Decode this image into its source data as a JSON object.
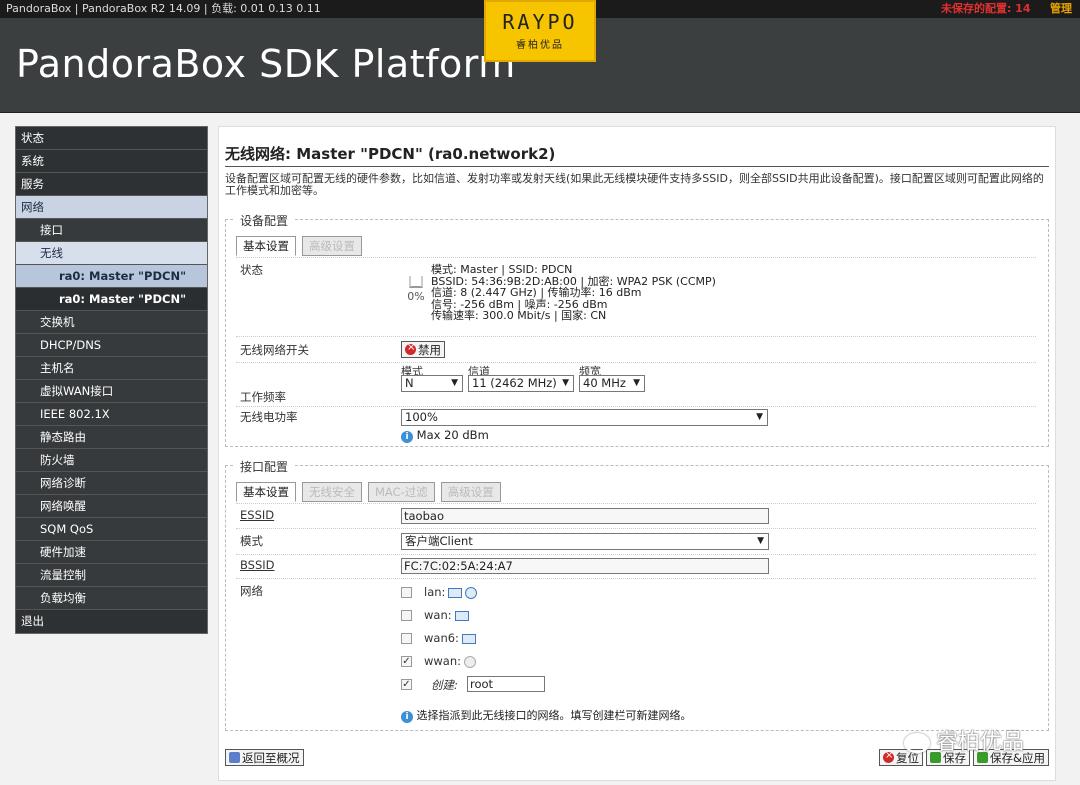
{
  "topbar": {
    "title": "PandoraBox | PandoraBox R2 14.09 | 负载: 0.01 0.13 0.11",
    "unsaved": "未保存的配置: 14",
    "admin": "管理"
  },
  "header": {
    "brand": "PandoraBox SDK Platform",
    "logo_main": "RAYPO",
    "logo_sub": "睿柏优品"
  },
  "sidebar": {
    "items": [
      {
        "label": "状态",
        "level": 1
      },
      {
        "label": "系统",
        "level": 1
      },
      {
        "label": "服务",
        "level": 1
      },
      {
        "label": "网络",
        "level": 1
      },
      {
        "label": "接口",
        "level": 2
      },
      {
        "label": "无线",
        "level": 2
      },
      {
        "label": "ra0: Master \"PDCN\"",
        "level": 3
      },
      {
        "label": "ra0: Master \"PDCN\"",
        "level": 3
      },
      {
        "label": "交换机",
        "level": 2
      },
      {
        "label": "DHCP/DNS",
        "level": 2
      },
      {
        "label": "主机名",
        "level": 2
      },
      {
        "label": "虚拟WAN接口",
        "level": 2
      },
      {
        "label": "IEEE 802.1X",
        "level": 2
      },
      {
        "label": "静态路由",
        "level": 2
      },
      {
        "label": "防火墙",
        "level": 2
      },
      {
        "label": "网络诊断",
        "level": 2
      },
      {
        "label": "网络唤醒",
        "level": 2
      },
      {
        "label": "SQM QoS",
        "level": 2
      },
      {
        "label": "硬件加速",
        "level": 2
      },
      {
        "label": "流量控制",
        "level": 2
      },
      {
        "label": "负载均衡",
        "level": 2
      },
      {
        "label": "退出",
        "level": 1
      }
    ]
  },
  "main": {
    "title": "无线网络: Master \"PDCN\" (ra0.network2)",
    "desc": "设备配置区域可配置无线的硬件参数，比如信道、发射功率或发射天线(如果此无线模块硬件支持多SSID，则全部SSID共用此设备配置)。接口配置区域则可配置此网络的工作模式和加密等。"
  },
  "device": {
    "legend": "设备配置",
    "tabs": [
      "基本设置",
      "高级设置"
    ],
    "status_label": "状态",
    "signal": "0%",
    "status_lines": {
      "l1": "模式: Master | SSID: PDCN",
      "l2": "BSSID: 54:36:9B:2D:AB:00 | 加密: WPA2 PSK (CCMP)",
      "l3": "信道: 8 (2.447 GHz) | 传输功率: 16 dBm",
      "l4": "信号: -256 dBm | 噪声: -256 dBm",
      "l5": "传输速率: 300.0 Mbit/s | 国家: CN"
    },
    "switch_label": "无线网络开关",
    "disable_btn": "禁用",
    "freq_label": "工作频率",
    "mode_lbl": "模式",
    "channel_lbl": "信道",
    "width_lbl": "频宽",
    "mode_val": "N",
    "channel_val": "11 (2462 MHz)",
    "width_val": "40 MHz",
    "power_label": "无线电功率",
    "power_val": "100%",
    "power_hint": "Max 20 dBm"
  },
  "iface": {
    "legend": "接口配置",
    "tabs": [
      "基本设置",
      "无线安全",
      "MAC-过滤",
      "高级设置"
    ],
    "essid_label": "ESSID",
    "essid_val": "taobao",
    "mode_label": "模式",
    "mode_val": "客户端Client",
    "bssid_label": "BSSID",
    "bssid_val": "FC:7C:02:5A:24:A7",
    "network_label": "网络",
    "networks": [
      "lan:",
      "wan:",
      "wan6:",
      "wwan:"
    ],
    "create_label": "创建:",
    "create_val": "root",
    "network_hint": "选择指派到此无线接口的网络。填写创建栏可新建网络。"
  },
  "footer": {
    "back": "返回至概况",
    "reset": "复位",
    "save": "保存",
    "apply": "保存&应用"
  },
  "watermark": "睿柏优品"
}
